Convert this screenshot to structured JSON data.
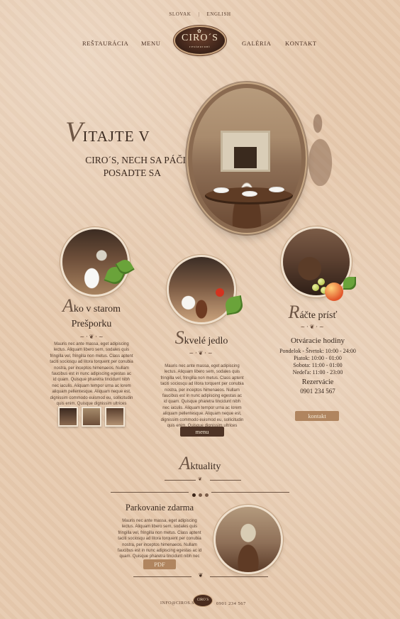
{
  "lang": {
    "slovak": "SLOVAK",
    "english": "ENGLISH"
  },
  "nav": {
    "items": [
      "REŠTAURÁCIA",
      "MENU",
      "GALÉRIA",
      "KONTAKT"
    ]
  },
  "logo": {
    "name": "CIRO´S",
    "sub": "restaurant"
  },
  "hero": {
    "initial": "V",
    "line1": "ITAJTE V",
    "line2": "CIRO´S, NECH SA PÁČI",
    "line3": "POSADTE SA"
  },
  "col1": {
    "initial": "A",
    "title_rest": "ko v starom",
    "title_line2": "Prešporku",
    "text": "Mauris nec ante massa, eget adipiscing lectus. Aliquam libero sem, sodales quis fringilla vel, fringilla non metus. Class aptent taciti sociosqu ad litora torquent per conubia nostra, per inceptos himenaeos. Nullam faucibus est in nunc adipiscing egestas ac id quam. Quisque pharetra tincidunt nibh nec iaculis. Aliquam tempor urna ac lorem aliquam pellentesque. Aliquam neque est, dignissim commodo euismod eu, sollicitudin quis enim. Quisque dignissim ultrices iaculis."
  },
  "col2": {
    "initial": "S",
    "title_rest": "kvelé jedlo",
    "text": "Mauris nec ante massa, eget adipiscing lectus. Aliquam libero sem, sodales quis fringilla vel, fringilla non metus. Class aptent taciti sociosqu ad litora torquent per conubia nostra, per inceptos himenaeos. Nullam faucibus est in nunc adipiscing egestas ac id quam. Quisque pharetra tincidunt nibh nec iaculis. Aliquam tempor urna ac lorem aliquam pellentesque. Aliquam neque est, dignissim commodo euismod eu, sollicitudin quis enim. Quisque dignissim ultrices iaculis.",
    "button": "menu"
  },
  "col3": {
    "initial": "R",
    "title_rest": "áčte prísť",
    "hours_title": "Otváracie hodiny",
    "hours": [
      "Pondelok - Štvrtok: 10:00 - 24:00",
      "Piatok: 10:00 - 01:00",
      "Sobota: 11:00 - 01:00",
      "Nedeľa: 11:00 - 23:00"
    ],
    "reservation": "Rezervácie",
    "phone": "0901 234 567",
    "button": "kontakt"
  },
  "news": {
    "initial": "A",
    "title_rest": "ktuality",
    "item_title": "Parkovanie zdarma",
    "text": "Mauris nec ante massa, eget adipiscing lectus. Aliquam libero sem, sodales quis fringilla vel, fringilla non metus. Class aptent taciti sociosqu ad litora torquent per conubia nostra, per inceptos himenaeos. Nullam faucibus est in nunc adipiscing egestas ac id quam. Quisque pharetra tincidunt nibh nec iaculis.",
    "button": "PDF"
  },
  "footer": {
    "email": "INFO@CIROS.SK",
    "phone": "0901 234 567",
    "logo": "CIRO´S"
  }
}
